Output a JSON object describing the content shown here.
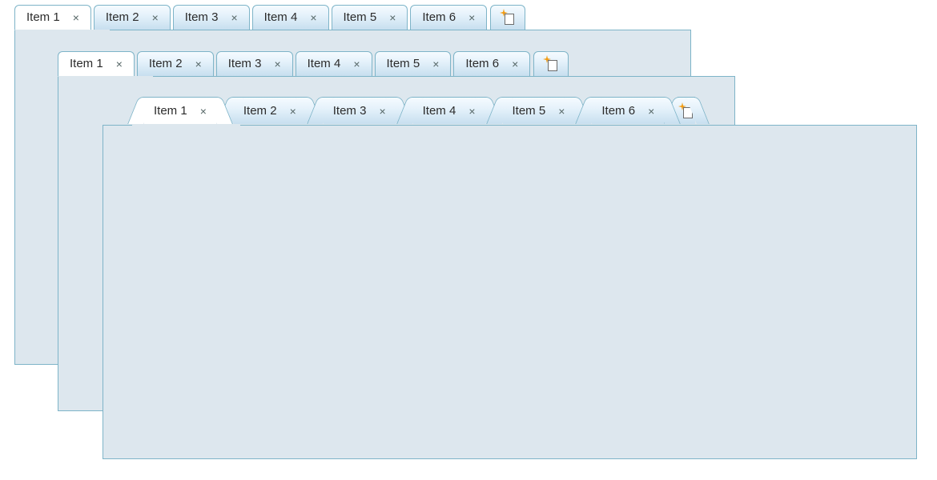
{
  "tabstrips": [
    {
      "id": "tabstrip-1",
      "style": "rect",
      "selectedIndex": 0,
      "tabs": [
        {
          "label": "Item 1",
          "closable": true
        },
        {
          "label": "Item 2",
          "closable": true
        },
        {
          "label": "Item 3",
          "closable": true
        },
        {
          "label": "Item 4",
          "closable": true
        },
        {
          "label": "Item 5",
          "closable": true
        },
        {
          "label": "Item 6",
          "closable": true
        }
      ],
      "newTab": {
        "iconName": "new-tab-icon"
      }
    },
    {
      "id": "tabstrip-2",
      "style": "rect",
      "selectedIndex": 0,
      "tabs": [
        {
          "label": "Item 1",
          "closable": true
        },
        {
          "label": "Item 2",
          "closable": true
        },
        {
          "label": "Item 3",
          "closable": true
        },
        {
          "label": "Item 4",
          "closable": true
        },
        {
          "label": "Item 5",
          "closable": true
        },
        {
          "label": "Item 6",
          "closable": true
        }
      ],
      "newTab": {
        "iconName": "new-tab-icon"
      }
    },
    {
      "id": "tabstrip-3",
      "style": "trapezoid",
      "selectedIndex": 0,
      "tabs": [
        {
          "label": "Item 1",
          "closable": true
        },
        {
          "label": "Item 2",
          "closable": true
        },
        {
          "label": "Item 3",
          "closable": true
        },
        {
          "label": "Item 4",
          "closable": true
        },
        {
          "label": "Item 5",
          "closable": true
        },
        {
          "label": "Item 6",
          "closable": true
        }
      ],
      "newTab": {
        "iconName": "new-tab-icon"
      }
    }
  ],
  "closeGlyph": "×",
  "colors": {
    "panelBorder": "#7eb4c8",
    "panelFill": "#dde7ee",
    "tabGradientTop": "#f5fbff",
    "tabGradientBottom": "#c7dfef",
    "selectedTab": "#ffffff",
    "sparkle": "#f39c12"
  }
}
